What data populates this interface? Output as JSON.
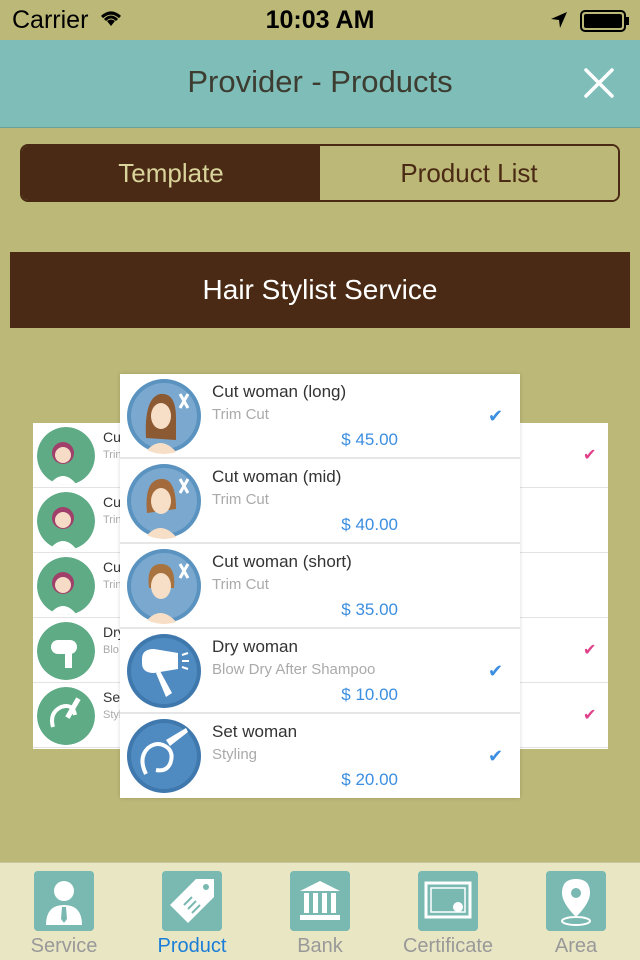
{
  "status_bar": {
    "carrier": "Carrier",
    "time": "10:03 AM"
  },
  "nav": {
    "title": "Provider - Products"
  },
  "segments": [
    {
      "label": "Template",
      "active": true
    },
    {
      "label": "Product List",
      "active": false
    }
  ],
  "banner": {
    "title": "Hair Stylist Service"
  },
  "preview_back": {
    "items": [
      {
        "name": "Cu",
        "sub": "Trin",
        "checked": true
      },
      {
        "name": "Cu",
        "sub": "Trin",
        "checked": false
      },
      {
        "name": "Cu",
        "sub": "Trin",
        "checked": false
      },
      {
        "name": "Dry",
        "sub": "Blo",
        "checked": true
      },
      {
        "name": "Set",
        "sub": "Styl",
        "checked": true
      }
    ]
  },
  "preview_front": {
    "items": [
      {
        "name": "Cut woman (long)",
        "sub": "Trim Cut",
        "price": "$ 45.00",
        "checked": true,
        "icon": "woman-long-hair-icon"
      },
      {
        "name": "Cut woman (mid)",
        "sub": "Trim Cut",
        "price": "$ 40.00",
        "checked": false,
        "icon": "woman-mid-hair-icon"
      },
      {
        "name": "Cut woman (short)",
        "sub": "Trim Cut",
        "price": "$ 35.00",
        "checked": false,
        "icon": "woman-short-hair-icon"
      },
      {
        "name": "Dry woman",
        "sub": "Blow Dry After Shampoo",
        "price": "$ 10.00",
        "checked": true,
        "icon": "hair-dryer-icon"
      },
      {
        "name": "Set woman",
        "sub": "Styling",
        "price": "$ 20.00",
        "checked": true,
        "icon": "hair-iron-icon"
      }
    ]
  },
  "tabs": [
    {
      "label": "Service",
      "icon": "person-icon",
      "active": false
    },
    {
      "label": "Product",
      "icon": "tag-icon",
      "active": true
    },
    {
      "label": "Bank",
      "icon": "bank-icon",
      "active": false
    },
    {
      "label": "Certificate",
      "icon": "certificate-icon",
      "active": false
    },
    {
      "label": "Area",
      "icon": "map-pin-icon",
      "active": false
    }
  ],
  "colors": {
    "background": "#bcb878",
    "nav": "#7fbdb8",
    "brown": "#4a2a14",
    "price": "#3c8ee0",
    "tab_active": "#1a7ed8",
    "check_back": "#e0408a"
  }
}
